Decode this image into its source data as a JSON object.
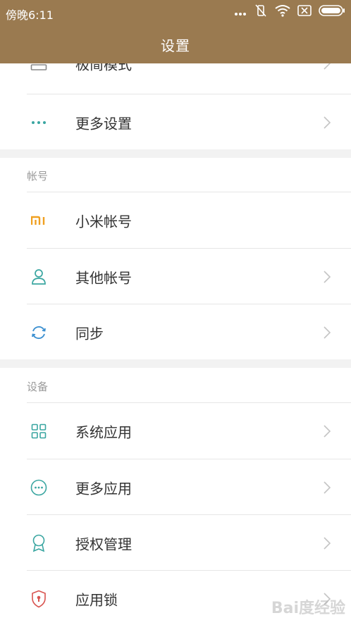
{
  "status_bar": {
    "time": "傍晚6:11"
  },
  "header": {
    "title": "设置"
  },
  "top_group": {
    "items": [
      {
        "label": "极简模式",
        "icon": "layout-list-icon"
      },
      {
        "label": "更多设置",
        "icon": "three-dots-icon"
      }
    ]
  },
  "account_section": {
    "title": "帐号",
    "items": [
      {
        "label": "小米帐号",
        "icon": "mi-logo-icon"
      },
      {
        "label": "其他帐号",
        "icon": "person-icon"
      },
      {
        "label": "同步",
        "icon": "sync-icon"
      }
    ]
  },
  "device_section": {
    "title": "设备",
    "items": [
      {
        "label": "系统应用",
        "icon": "apps-grid-icon"
      },
      {
        "label": "更多应用",
        "icon": "more-apps-icon"
      },
      {
        "label": "授权管理",
        "icon": "badge-icon"
      },
      {
        "label": "应用锁",
        "icon": "shield-lock-icon"
      }
    ]
  },
  "colors": {
    "header_bg": "#9a7a50",
    "icon_teal": "#3aa6a1",
    "mi_orange": "#f0a020",
    "lock_red": "#d9534f"
  },
  "watermark": "Bai度经验"
}
